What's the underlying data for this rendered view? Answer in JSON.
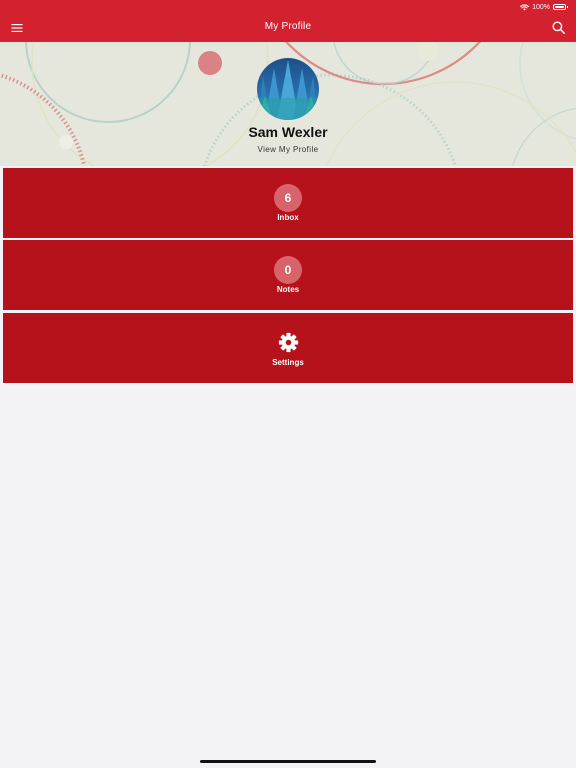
{
  "status_bar": {
    "battery_text": "100%",
    "battery_level": 1.0
  },
  "nav": {
    "title": "My Profile",
    "left_icon": "hamburger-menu-icon",
    "right_icon": "search-icon"
  },
  "profile": {
    "name": "Sam Wexler",
    "link_label": "View My Profile"
  },
  "tiles": [
    {
      "badge": "6",
      "label": "Inbox"
    },
    {
      "badge": "0",
      "label": "Notes"
    },
    {
      "icon": "gear-icon",
      "label": "Settings"
    }
  ],
  "colors": {
    "brand_red": "#d3212f",
    "tile_red": "#b5121b",
    "badge_pink": "#d9636b",
    "page_background": "#f2f2f7",
    "header_background": "#e6e7dc"
  }
}
